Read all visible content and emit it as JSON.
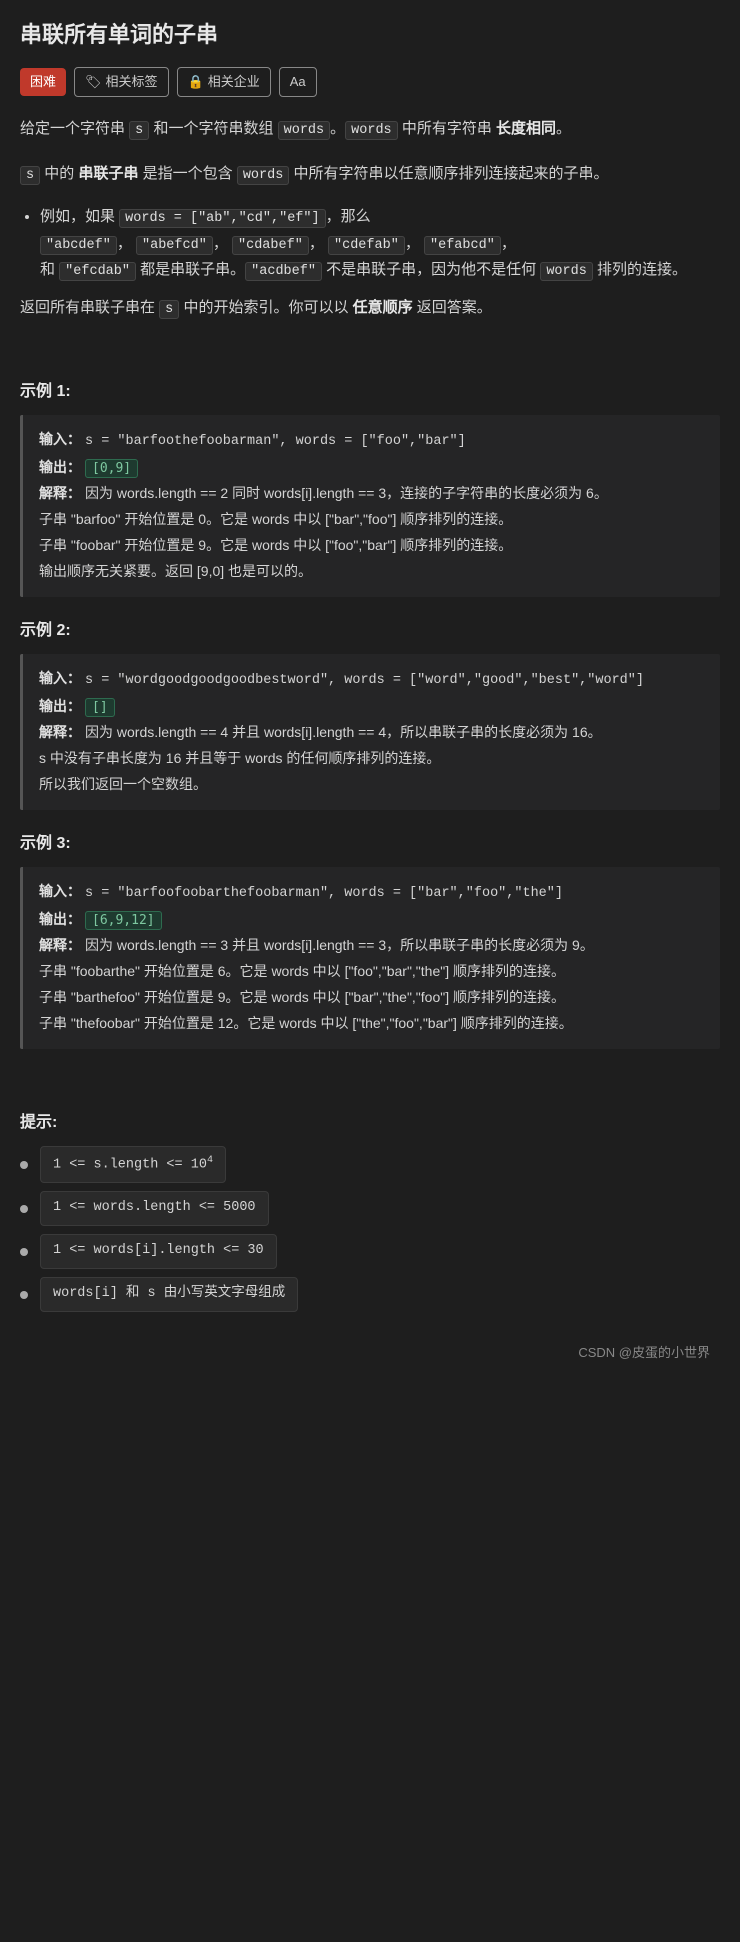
{
  "page": {
    "title": "串联所有单词的子串",
    "difficulty": "困难",
    "tag_related": "相关标签",
    "tag_company": "相关企业",
    "tag_font": "Aa",
    "tag_related_icon": "🏷",
    "tag_company_icon": "🔒"
  },
  "description": {
    "para1_pre": "给定一个字符串",
    "s_code": "s",
    "para1_mid": "和一个字符串数组",
    "words_code": "words",
    "para1_end1": "。",
    "words_code2": "words",
    "para1_end2": "中所有字符串",
    "bold1": "长度相同",
    "para1_end3": "。",
    "para2_pre": "中的",
    "s_code2": "s",
    "bold2": "串联子串",
    "para2_mid": "是指一个包含",
    "words_code3": "words",
    "para2_end": "中所有字符串以任意顺序排列连接起来的子串。",
    "example_intro": "例如，如果",
    "words_example": "words = [\"ab\",\"cd\",\"ef\"]",
    "example_mid": "，那么",
    "valid_strings": [
      "\"abcdef\"",
      "\"abefcd\"",
      "\"cdabef\"",
      "\"cdefab\"",
      "\"efabcd\"",
      "和",
      "\"efcdab\""
    ],
    "valid_end": "都是串联子串。",
    "invalid_code": "\"acdbef\"",
    "invalid_end": "不是串联子串，因为他不是任何",
    "words_code4": "words",
    "invalid_end2": "排列的连接。",
    "return_desc": "返回所有串联子串在",
    "s_code3": "s",
    "return_end": "中的开始索引。你可以以",
    "bold3": "任意顺序",
    "return_end2": "返回答案。"
  },
  "examples": [
    {
      "title": "示例 1:",
      "input_label": "输入：",
      "input_value": "s = \"barfoothefoobarman\", words = [\"foo\",\"bar\"]",
      "output_label": "输出：",
      "output_value": "[0,9]",
      "explanation_label": "解释：",
      "explanation": "因为 words.length == 2 同时 words[i].length == 3，连接的子字符串的长度必须为 6。\n子串 \"barfoo\" 开始位置是 0。它是 words 中以 [\"bar\",\"foo\"] 顺序排列的连接。\n子串 \"foobar\" 开始位置是 9。它是 words 中以 [\"foo\",\"bar\"] 顺序排列的连接。\n输出顺序无关紧要。返回 [9,0] 也是可以的。"
    },
    {
      "title": "示例 2:",
      "input_label": "输入：",
      "input_value": "s = \"wordgoodgoodgoodbestword\", words = [\"word\",\"good\",\"best\",\"word\"]",
      "output_label": "输出：",
      "output_value": "[]",
      "explanation_label": "解释：",
      "explanation": "因为 words.length == 4 并且 words[i].length == 4，所以串联子串的长度必须为 16。\ns 中没有子串长度为 16 并且等于 words 的任何顺序排列的连接。\n所以我们返回一个空数组。"
    },
    {
      "title": "示例 3:",
      "input_label": "输入：",
      "input_value": "s = \"barfoofoobarthefoobarman\", words = [\"bar\",\"foo\",\"the\"]",
      "output_label": "输出：",
      "output_value": "[6,9,12]",
      "explanation_label": "解释：",
      "explanation": "因为 words.length == 3 并且 words[i].length == 3，所以串联子串的长度必须为 9。\n子串 \"foobarthe\" 开始位置是 6。它是 words 中以 [\"foo\",\"bar\",\"the\"] 顺序排列的连接。\n子串 \"barthefoo\" 开始位置是 9。它是 words 中以 [\"bar\",\"the\",\"foo\"] 顺序排列的连接。\n子串 \"thefoobar\" 开始位置是 12。它是 words 中以 [\"the\",\"foo\",\"bar\"] 顺序排列的连接。"
    }
  ],
  "hints": {
    "title": "提示:",
    "items": [
      "1 <= s.length <= 10⁴",
      "1 <= words.length <= 5000",
      "1 <= words[i].length <= 30",
      "words[i] 和 s 由小写英文字母组成"
    ],
    "items_html": [
      "1 <= s.length <= 10<sup>4</sup>",
      "1 <= words.length <= 5000",
      "1 <= words[i].length <= 30",
      "words[i] 和 s 由小写英文字母组成"
    ]
  },
  "footer": {
    "text": "CSDN @皮蛋的小世界"
  }
}
